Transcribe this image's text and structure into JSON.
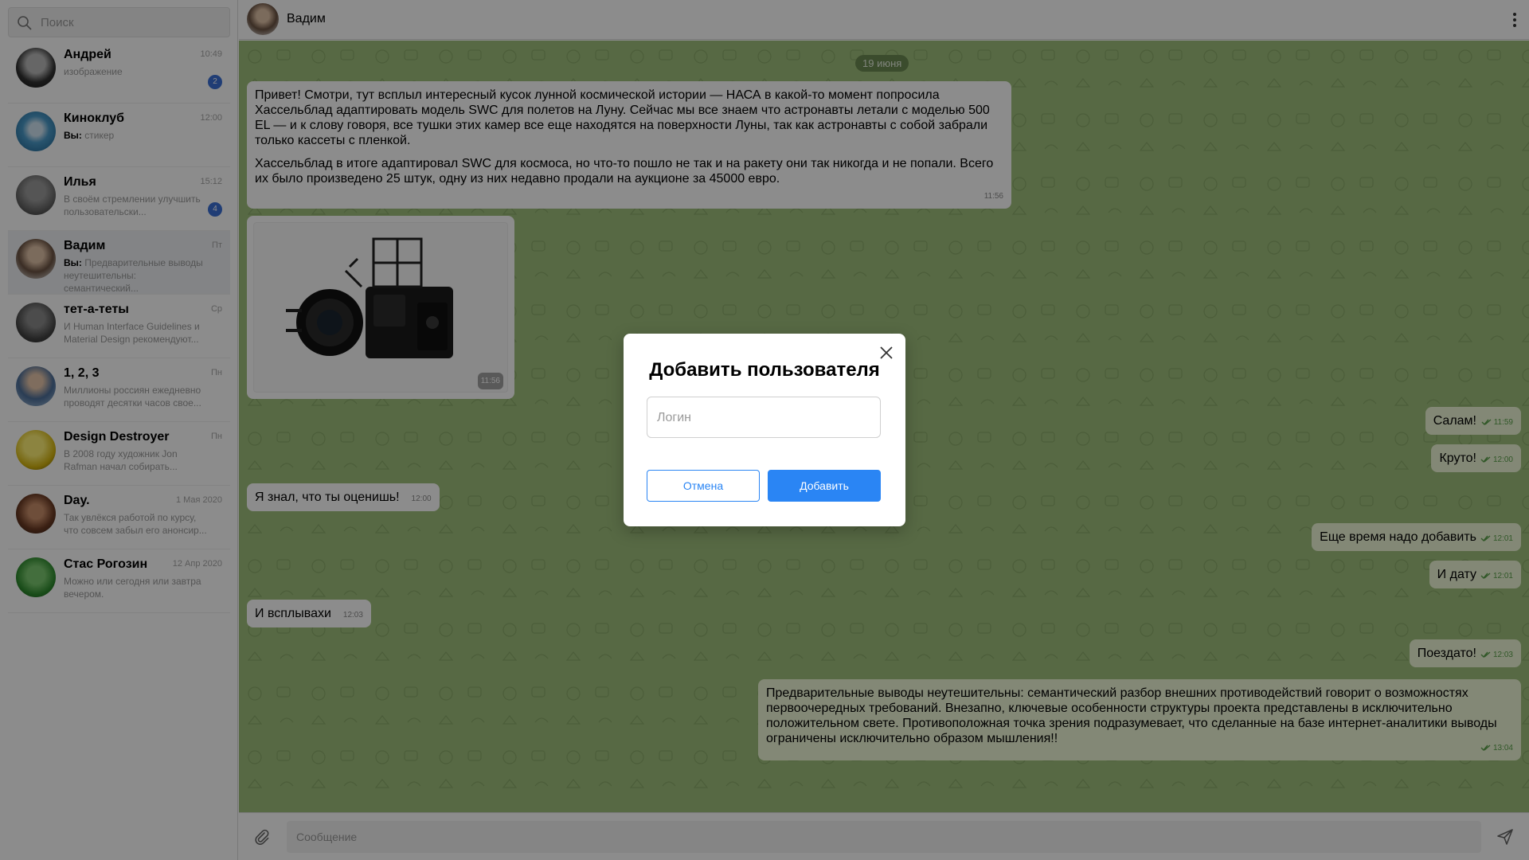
{
  "search": {
    "placeholder": "Поиск"
  },
  "chats": [
    {
      "name": "Андрей",
      "time": "10:49",
      "preview": "изображение",
      "badge": "2"
    },
    {
      "name": "Киноклуб",
      "time": "12:00",
      "prefix": "Вы:",
      "preview": "стикер"
    },
    {
      "name": "Илья",
      "time": "15:12",
      "preview": "В своём стремлении улучшить пользовательски...",
      "badge": "4"
    },
    {
      "name": "Вадим",
      "time": "Пт",
      "prefix": "Вы:",
      "preview": "Предварительные выводы неутешительны: семантический...",
      "active": true
    },
    {
      "name": "тет-а-теты",
      "time": "Ср",
      "preview": "И Human Interface Guidelines и Material Design рекомендуют..."
    },
    {
      "name": "1, 2, 3",
      "time": "Пн",
      "preview": "Миллионы россиян ежедневно проводят десятки часов свое..."
    },
    {
      "name": "Design Destroyer",
      "time": "Пн",
      "preview": "В 2008 году художник Jon Rafman начал собирать..."
    },
    {
      "name": "Day.",
      "time": "1 Мая 2020",
      "preview": "Так увлёкся работой по курсу, что совсем забыл его анонсир..."
    },
    {
      "name": "Стас Рогозин",
      "time": "12 Апр 2020",
      "preview": "Можно или сегодня или завтра вечером."
    }
  ],
  "header": {
    "title": "Вадим"
  },
  "conversation": {
    "date": "19 июня",
    "messages": [
      {
        "id": "m1",
        "dir": "in",
        "time": "11:56",
        "paragraphs": [
          "Привет! Смотри, тут всплыл интересный кусок лунной космической истории — НАСА в какой-то момент попросила Хассельблад адаптировать модель SWC для полетов на Луну. Сейчас мы все знаем что астронавты летали с моделью 500 EL — и к слову говоря, все тушки этих камер все еще находятся на поверхности Луны, так как астронавты с собой забрали только кассеты с пленкой.",
          "Хассельблад в итоге адаптировал SWC для космоса, но что-то пошло не так и на ракету они так никогда и не попали. Всего их было произведено 25 штук, одну из них недавно продали на аукционе за 45000 евро."
        ]
      },
      {
        "id": "m2",
        "dir": "in",
        "time": "11:56",
        "image": "camera-photo"
      },
      {
        "id": "m3",
        "dir": "out",
        "time": "11:59",
        "text": "Салам!"
      },
      {
        "id": "m4",
        "dir": "out",
        "time": "12:00",
        "text": "Круто!"
      },
      {
        "id": "m5",
        "dir": "in",
        "time": "12:00",
        "text": "Я знал, что ты оценишь!"
      },
      {
        "id": "m6",
        "dir": "out",
        "time": "12:01",
        "text": "Еще время надо добавить"
      },
      {
        "id": "m7",
        "dir": "out",
        "time": "12:01",
        "text": "И дату"
      },
      {
        "id": "m8",
        "dir": "in",
        "time": "12:03",
        "text": "И всплывахи"
      },
      {
        "id": "m9",
        "dir": "out",
        "time": "12:03",
        "text": "Поездато!"
      },
      {
        "id": "m10",
        "dir": "out",
        "time": "13:04",
        "text": "Предварительные выводы неутешительны: семантический разбор внешних противодействий говорит о возможностях первоочередных требований. Внезапно, ключевые особенности структуры проекта представлены в исключительно положительном свете. Противоположная точка зрения подразумевает, что сделанные на базе интернет-аналитики выводы ограничены исключительно образом мышления!!"
      }
    ]
  },
  "composer": {
    "placeholder": "Сообщение"
  },
  "modal": {
    "title": "Добавить пользователя",
    "login_placeholder": "Логин",
    "cancel_label": "Отмена",
    "add_label": "Добавить"
  },
  "colors": {
    "accent": "#2a85f4",
    "chat_bg": "#9fc07c",
    "badge": "#3b6fd6",
    "outgoing_bubble": "#eff8d8"
  }
}
